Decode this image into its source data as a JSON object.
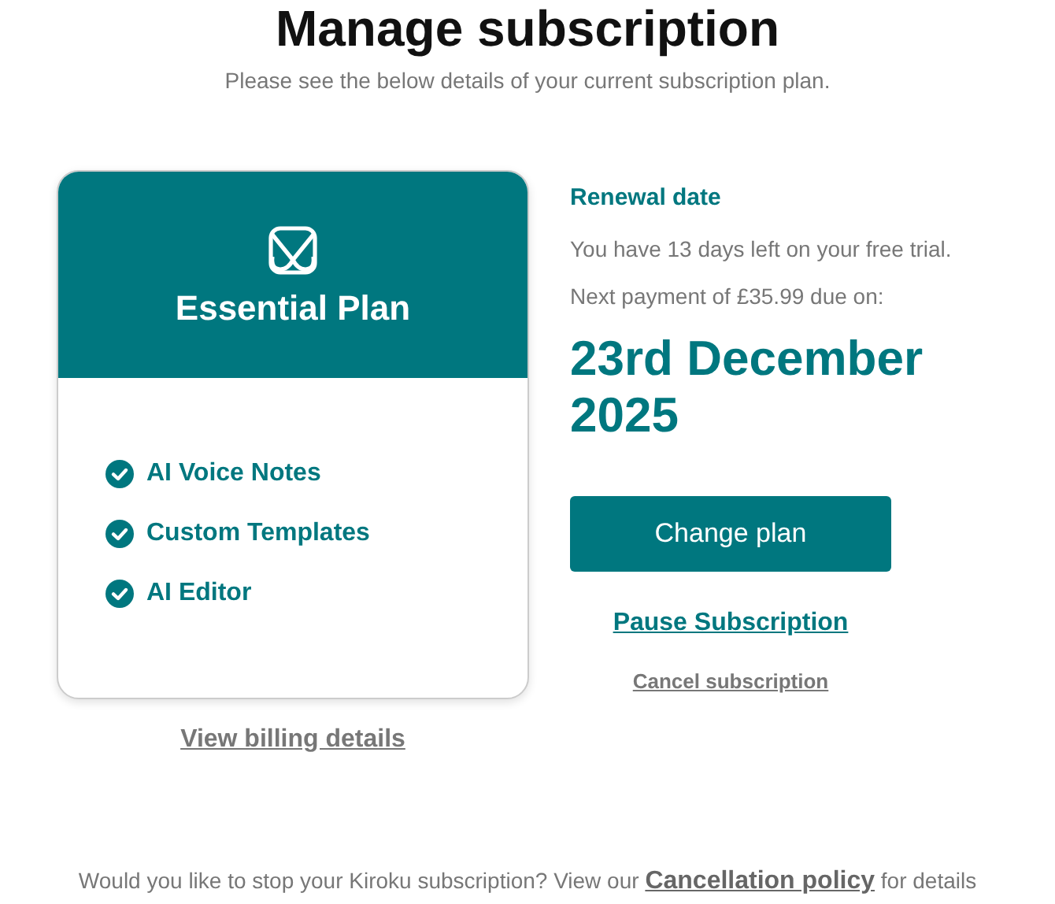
{
  "header": {
    "title": "Manage subscription",
    "subtitle": "Please see the below details of your current subscription plan."
  },
  "plan": {
    "name": "Essential Plan",
    "features": [
      {
        "label": "AI Voice Notes",
        "included": true
      },
      {
        "label": "Custom Templates",
        "included": true
      },
      {
        "label": "AI Editor",
        "included": true
      }
    ],
    "billing_link": "View billing details"
  },
  "renewal": {
    "heading": "Renewal date",
    "trial_text": "You have 13 days left on your free trial.",
    "payment_text": "Next payment of £35.99 due on:",
    "date": "23rd December 2025"
  },
  "actions": {
    "primary": "Change plan",
    "pause": "Pause Subscription",
    "cancel": "Cancel subscription"
  },
  "footer": {
    "before": "Would you like to stop your Kiroku subscription? View our",
    "link": "Cancellation policy",
    "after": "for details"
  }
}
